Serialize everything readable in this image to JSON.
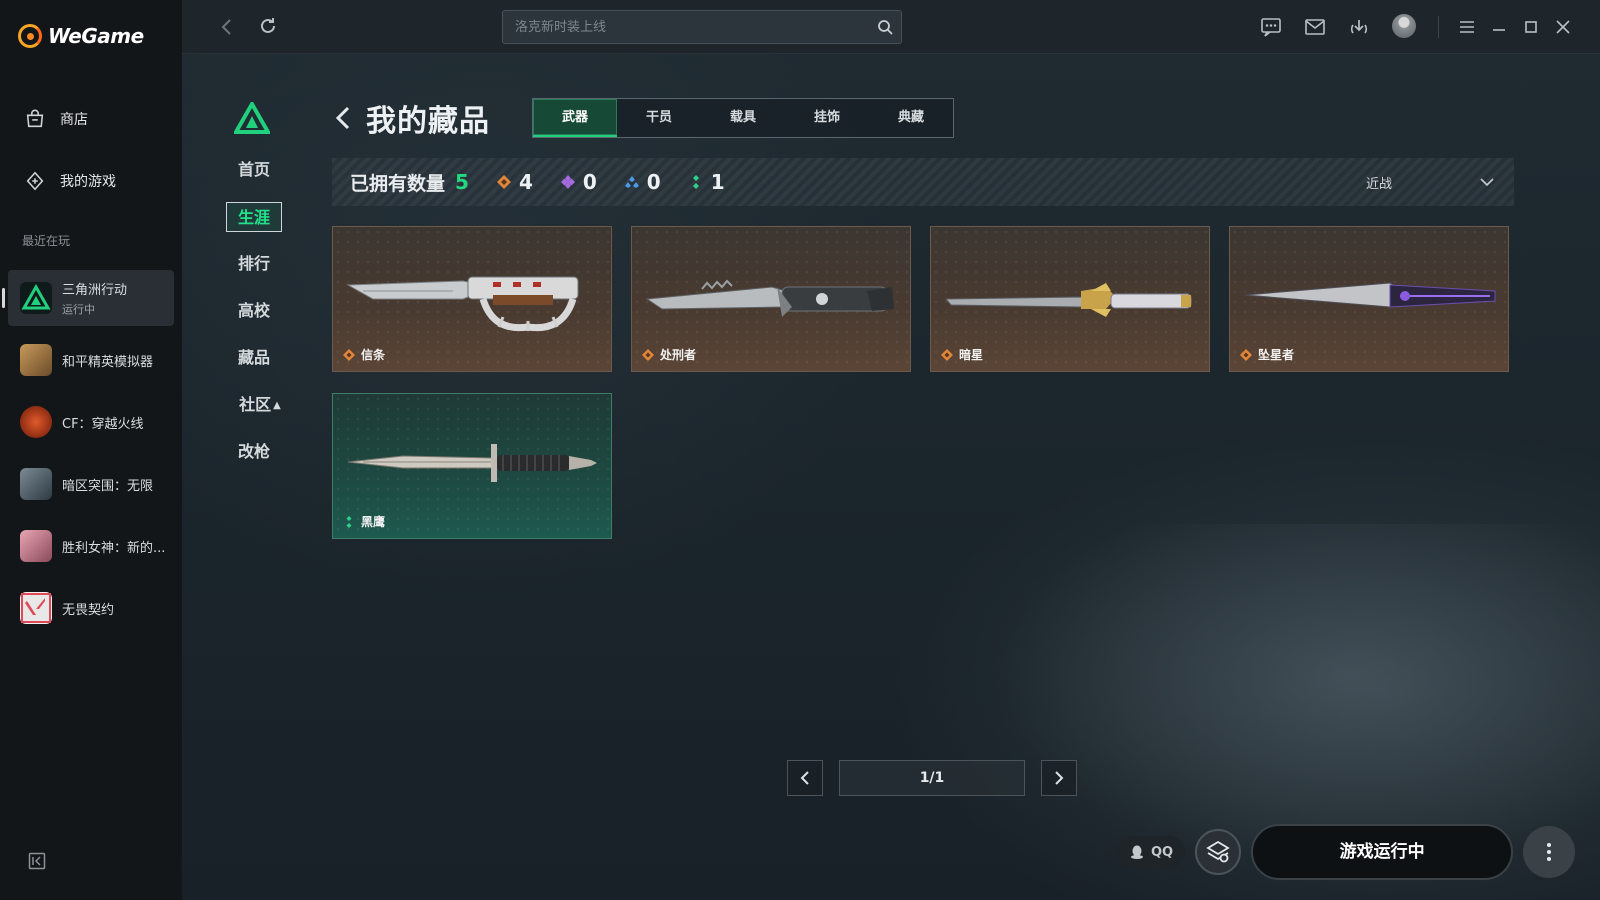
{
  "app": {
    "brand": "WeGame"
  },
  "sidebar": {
    "nav": [
      {
        "label": "商店",
        "icon": "shop-bag-icon"
      },
      {
        "label": "我的游戏",
        "icon": "controller-icon"
      }
    ],
    "recent_title": "最近在玩",
    "games": [
      {
        "name": "三角洲行动",
        "status": "运行中",
        "active": true
      },
      {
        "name": "和平精英模拟器",
        "status": ""
      },
      {
        "name": "CF：穿越火线",
        "status": ""
      },
      {
        "name": "暗区突围：无限",
        "status": ""
      },
      {
        "name": "胜利女神：新的...",
        "status": ""
      },
      {
        "name": "无畏契约",
        "status": ""
      }
    ]
  },
  "topbar": {
    "search_placeholder": "洛克新时装上线"
  },
  "game_nav": {
    "items": [
      "首页",
      "生涯",
      "排行",
      "高校",
      "藏品",
      "社区",
      "改枪"
    ],
    "active": "生涯"
  },
  "collection": {
    "title": "我的藏品",
    "tabs": [
      "武器",
      "干员",
      "载具",
      "挂饰",
      "典藏"
    ],
    "active_tab": "武器",
    "owned_label": "已拥有数量",
    "owned_count": "5",
    "rarity_counts": [
      {
        "rarity": "orange",
        "color": "#e0873c",
        "count": "4"
      },
      {
        "rarity": "purple",
        "color": "#a66be0",
        "count": "0"
      },
      {
        "rarity": "blue",
        "color": "#4a9ae8",
        "count": "0"
      },
      {
        "rarity": "green",
        "color": "#2fd28a",
        "count": "1"
      }
    ],
    "filter_value": "近战",
    "items": [
      {
        "name": "信条",
        "rarity": "orange"
      },
      {
        "name": "处刑者",
        "rarity": "orange"
      },
      {
        "name": "暗星",
        "rarity": "orange"
      },
      {
        "name": "坠星者",
        "rarity": "orange"
      },
      {
        "name": "黑鹰",
        "rarity": "green"
      }
    ],
    "pager": {
      "display": "1/1"
    }
  },
  "bottom": {
    "qq_label": "QQ",
    "launch_label": "游戏运行中"
  },
  "colors": {
    "accent_green": "#22d97f",
    "tab_active_bg": "#174a36"
  }
}
